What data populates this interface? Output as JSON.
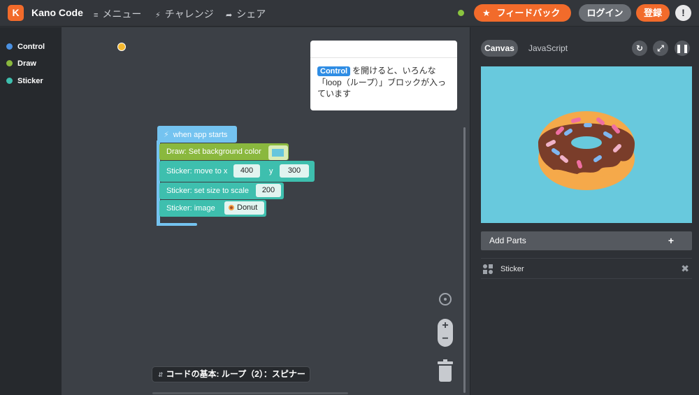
{
  "header": {
    "logo_letter": "K",
    "app_title": "Kano Code",
    "nav": [
      {
        "icon": "menu-icon",
        "glyph": "≡",
        "label": "メニュー"
      },
      {
        "icon": "bolt-icon",
        "glyph": "⚡",
        "label": "チャレンジ"
      },
      {
        "icon": "share-icon",
        "glyph": "➦",
        "label": "シェア"
      }
    ],
    "feedback_label": "フィードバック",
    "login_label": "ログイン",
    "register_label": "登録",
    "alert_glyph": "!"
  },
  "sidebar": {
    "categories": [
      {
        "label": "Control",
        "color": "#4a90e2"
      },
      {
        "label": "Draw",
        "color": "#8ab83e"
      },
      {
        "label": "Sticker",
        "color": "#3ebfae"
      }
    ]
  },
  "tooltip": {
    "chip": "Control",
    "text": "を開けると、いろんな「loop（ループ）」ブロックが入っています"
  },
  "blocks": {
    "hat": "when app starts",
    "draw": "Draw: Set background color",
    "move": "Sticker: move to x",
    "move_x": "400",
    "move_y_label": "y",
    "move_y": "300",
    "scale": "Sticker: set size to scale",
    "scale_value": "200",
    "image": "Sticker: image",
    "image_value": "Donut"
  },
  "lesson": {
    "label": "コードの基本: ループ（2）：スピナー"
  },
  "right_panel": {
    "tab_canvas": "Canvas",
    "tab_js": "JavaScript",
    "add_parts": "Add Parts",
    "add_glyph": "+",
    "part_name": "Sticker",
    "remove_glyph": "✖"
  },
  "colors": {
    "brand": "#f26b2b",
    "canvas_bg": "#68c9dd",
    "control": "#74c3f0",
    "draw": "#8ab83e",
    "sticker": "#3ebfae"
  }
}
